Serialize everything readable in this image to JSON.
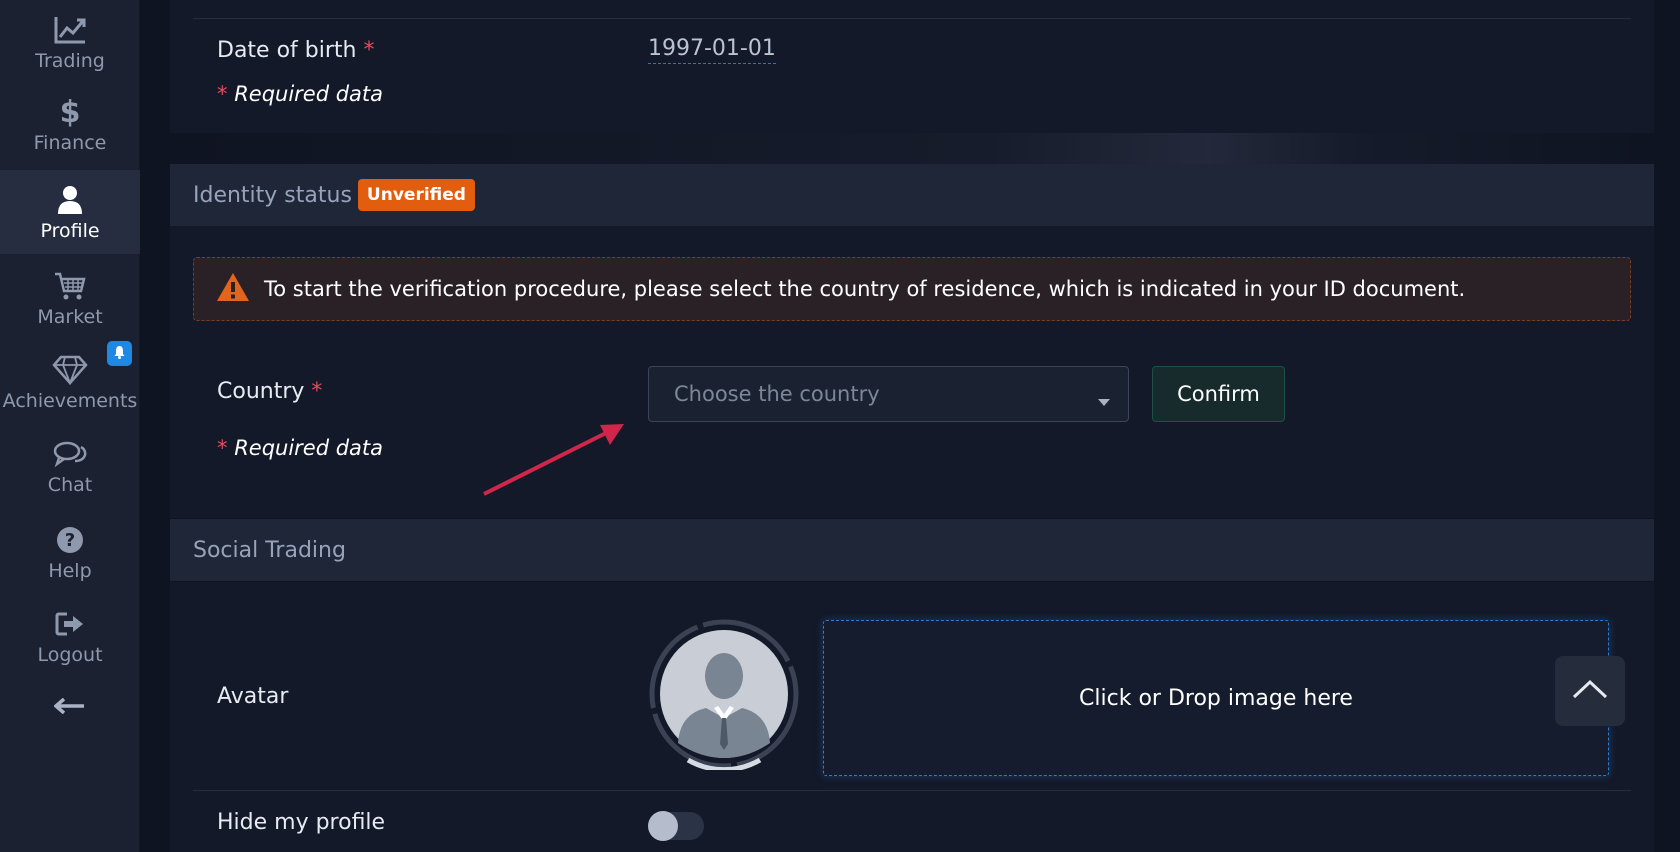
{
  "sidebar": {
    "items": [
      {
        "label": "Trading",
        "icon": "chart-line-icon"
      },
      {
        "label": "Finance",
        "icon": "dollar-icon"
      },
      {
        "label": "Profile",
        "icon": "user-icon"
      },
      {
        "label": "Market",
        "icon": "cart-icon"
      },
      {
        "label": "Achievements",
        "icon": "diamond-icon"
      },
      {
        "label": "Chat",
        "icon": "chat-icon"
      },
      {
        "label": "Help",
        "icon": "help-icon"
      },
      {
        "label": "Logout",
        "icon": "logout-icon"
      }
    ],
    "active": "Profile",
    "achievements_badge_icon": "bell-icon"
  },
  "personal": {
    "dob_label": "Date of birth",
    "required_star": "*",
    "dob_value": "1997-01-01",
    "required_note": "Required data"
  },
  "identity": {
    "title": "Identity status",
    "status_badge": "Unverified",
    "alert_text": "To start the verification procedure, please select the country of residence, which is indicated in your ID document.",
    "country_label": "Country",
    "country_placeholder": "Choose the country",
    "confirm_label": "Confirm",
    "required_note": "Required data"
  },
  "social": {
    "title": "Social Trading",
    "avatar_label": "Avatar",
    "dropzone_text": "Click or Drop image here",
    "hide_profile_label": "Hide my profile",
    "hide_profile_on": false
  },
  "colors": {
    "accent_blue": "#1e88e5",
    "badge_orange": "#e35d0f",
    "required_red": "#e84a5f",
    "annotation_arrow": "#d0264a"
  }
}
